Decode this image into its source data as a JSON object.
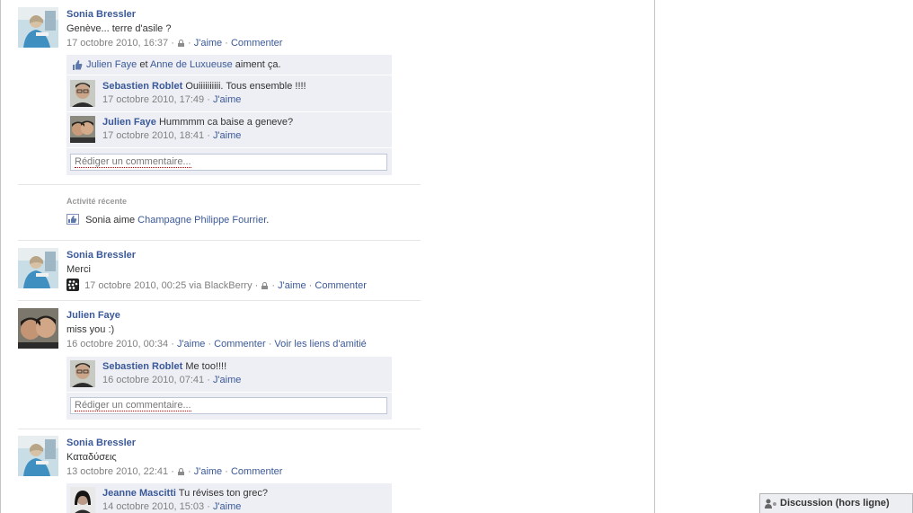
{
  "feed": {
    "stories": [
      {
        "author": "Sonia Bressler",
        "message": "Genève... terre d'asile ?",
        "timestamp": "17 octobre 2010, 16:37",
        "actions": [
          "J'aime",
          "Commenter"
        ],
        "likes": {
          "user1": "Julien Faye",
          "conj": "et",
          "user2": "Anne de Luxueuse",
          "suffix": "aiment ça."
        },
        "comments": [
          {
            "author": "Sebastien Roblet",
            "text": "Ouiiiiiiiiii. Tous ensemble !!!!",
            "timestamp": "17 octobre 2010, 17:49",
            "like": "J'aime"
          },
          {
            "author": "Julien Faye",
            "text": "Hummmm ca baise a geneve?",
            "timestamp": "17 octobre 2010, 18:41",
            "like": "J'aime"
          }
        ],
        "comment_placeholder": "Rédiger un commentaire..."
      },
      {
        "author": "Sonia Bressler",
        "message": "Merci",
        "timestamp": "17 octobre 2010, 00:25 via BlackBerry",
        "actions": [
          "J'aime",
          "Commenter"
        ]
      },
      {
        "author": "Julien Faye",
        "message": "miss you :)",
        "timestamp": "16 octobre 2010, 00:34",
        "actions": [
          "J'aime",
          "Commenter",
          "Voir les liens d'amitié"
        ],
        "comments": [
          {
            "author": "Sebastien Roblet",
            "text": "Me too!!!!",
            "timestamp": "16 octobre 2010, 07:41",
            "like": "J'aime"
          }
        ],
        "comment_placeholder": "Rédiger un commentaire..."
      },
      {
        "author": "Sonia Bressler",
        "message": "Καταδύσεις",
        "timestamp": "13 octobre 2010, 22:41",
        "actions": [
          "J'aime",
          "Commenter"
        ],
        "comments": [
          {
            "author": "Jeanne Mascitti",
            "text": "Tu révises ton grec?",
            "timestamp": "14 octobre 2010, 15:03",
            "like": "J'aime"
          }
        ]
      }
    ],
    "activity": {
      "title": "Activité récente",
      "text": "Sonia aime",
      "page": "Champagne Philippe Fourrier",
      "end": "."
    }
  },
  "chat": {
    "label": "Discussion (hors ligne)"
  },
  "icons": [
    "like-thumb-icon",
    "lock-icon",
    "blackberry-icon",
    "chat-person-icon"
  ],
  "colors": {
    "link": "#3b5998",
    "meta": "#808080",
    "comment_bg": "#edeff4"
  }
}
